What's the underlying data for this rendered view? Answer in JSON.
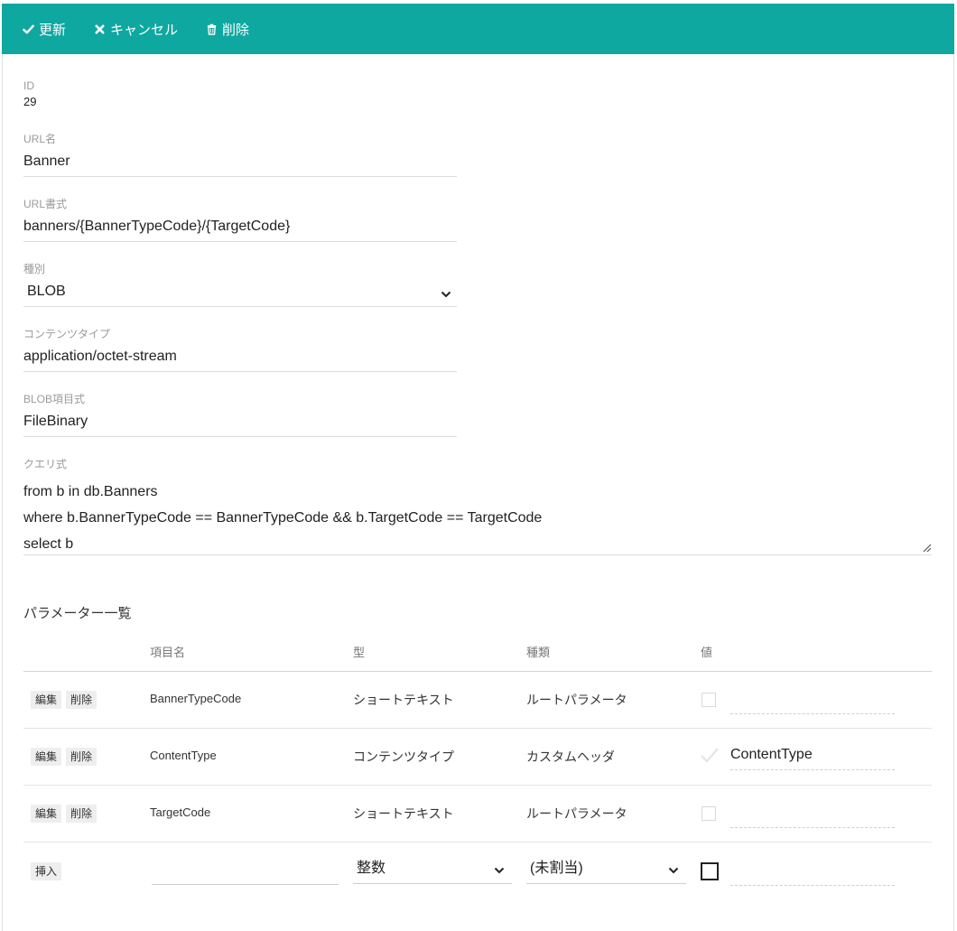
{
  "toolbar": {
    "update_label": "更新",
    "cancel_label": "キャンセル",
    "delete_label": "削除",
    "background": "#0ea8a0"
  },
  "form": {
    "id_label": "ID",
    "id_value": "29",
    "url_name_label": "URL名",
    "url_name_value": "Banner",
    "url_format_label": "URL書式",
    "url_format_value": "banners/{BannerTypeCode}/{TargetCode}",
    "kind_label": "種別",
    "kind_value": "BLOB",
    "content_type_label": "コンテンツタイプ",
    "content_type_value": "application/octet-stream",
    "blob_expr_label": "BLOB項目式",
    "blob_expr_value": "FileBinary",
    "query_label": "クエリ式",
    "query_lines": [
      "from b in db.Banners",
      "where b.BannerTypeCode == BannerTypeCode && b.TargetCode == TargetCode",
      "select b"
    ]
  },
  "params": {
    "title": "パラメーター一覧",
    "headers": {
      "name": "項目名",
      "type": "型",
      "kind": "種類",
      "value": "値"
    },
    "edit_label": "編集",
    "delete_label": "削除",
    "rows": [
      {
        "name": "BannerTypeCode",
        "type": "ショートテキスト",
        "kind": "ルートパラメータ",
        "checked": false,
        "value": ""
      },
      {
        "name": "ContentType",
        "type": "コンテンツタイプ",
        "kind": "カスタムヘッダ",
        "checked": true,
        "value": "ContentType"
      },
      {
        "name": "TargetCode",
        "type": "ショートテキスト",
        "kind": "ルートパラメータ",
        "checked": false,
        "value": ""
      }
    ],
    "insert_row": {
      "insert_label": "挿入",
      "name_value": "",
      "type_value": "整数",
      "kind_value": "(未割当)",
      "value": ""
    }
  },
  "icons": {
    "update": "check-icon",
    "cancel": "times-icon",
    "delete": "trash-icon",
    "dropdown": "chevron-down-icon",
    "resize": "resize-handle-icon"
  }
}
